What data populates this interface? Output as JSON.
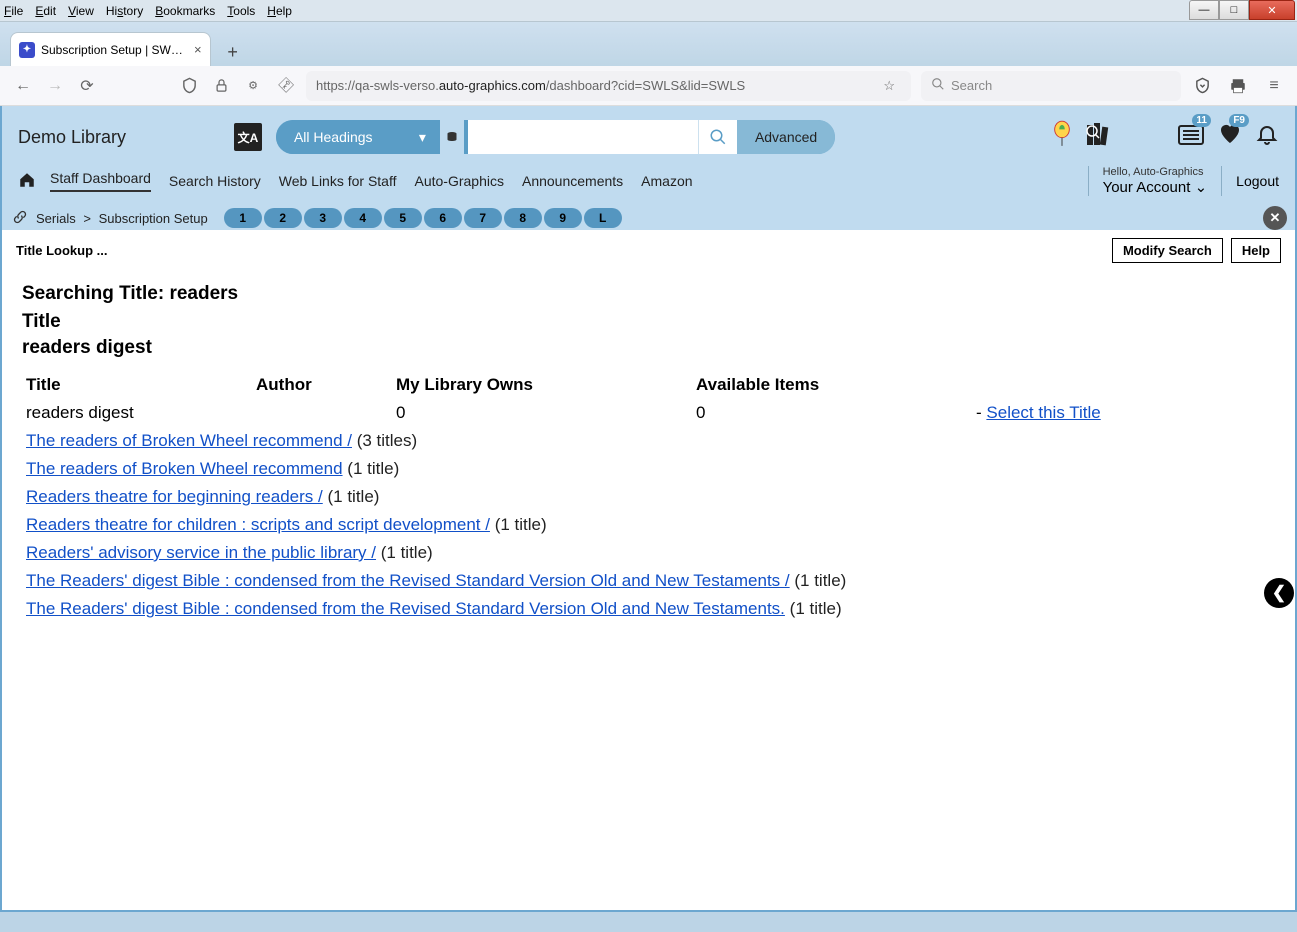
{
  "browser": {
    "menu": [
      "File",
      "Edit",
      "View",
      "History",
      "Bookmarks",
      "Tools",
      "Help"
    ],
    "tab_title": "Subscription Setup | SWLS | swls",
    "url_prefix": "https://qa-swls-verso.",
    "url_bold": "auto-graphics.com",
    "url_suffix": "/dashboard?cid=SWLS&lid=SWLS",
    "search_placeholder": "Search"
  },
  "header": {
    "library_name": "Demo Library",
    "headings_label": "All Headings",
    "advanced_label": "Advanced",
    "cart_badge": "11",
    "heart_badge": "F9"
  },
  "nav": {
    "items": [
      "Staff Dashboard",
      "Search History",
      "Web Links for Staff",
      "Auto-Graphics",
      "Announcements",
      "Amazon"
    ],
    "hello": "Hello, Auto-Graphics",
    "account": "Your Account",
    "logout": "Logout"
  },
  "breadcrumb": {
    "a": "Serials",
    "b": "Subscription Setup",
    "tabs": [
      "1",
      "2",
      "3",
      "4",
      "5",
      "6",
      "7",
      "8",
      "9",
      "L"
    ]
  },
  "page": {
    "title_lookup": "Title Lookup ...",
    "modify_search": "Modify Search",
    "help": "Help",
    "searching": "Searching Title: readers",
    "sub1": "Title",
    "sub2": "readers digest",
    "col_title": "Title",
    "col_author": "Author",
    "col_owns": "My Library Owns",
    "col_avail": "Available Items",
    "row1_title": "readers digest",
    "row1_owns": "0",
    "row1_avail": "0",
    "row1_dash": "-",
    "select_title": "Select this Title",
    "links": [
      {
        "text": "The readers of Broken Wheel recommend /",
        "count": "(3 titles)"
      },
      {
        "text": "The readers of Broken Wheel recommend",
        "count": "(1 title)"
      },
      {
        "text": "Readers theatre for beginning readers /",
        "count": "(1 title)"
      },
      {
        "text": "Readers theatre for children : scripts and script development /",
        "count": "(1 title)"
      },
      {
        "text": "Readers' advisory service in the public library /",
        "count": "(1 title)"
      },
      {
        "text": "The Readers' digest Bible : condensed from the Revised Standard Version Old and New Testaments /",
        "count": "(1 title)"
      },
      {
        "text": "The Readers' digest Bible : condensed from the Revised Standard Version Old and New Testaments.",
        "count": "(1 title)"
      }
    ]
  }
}
